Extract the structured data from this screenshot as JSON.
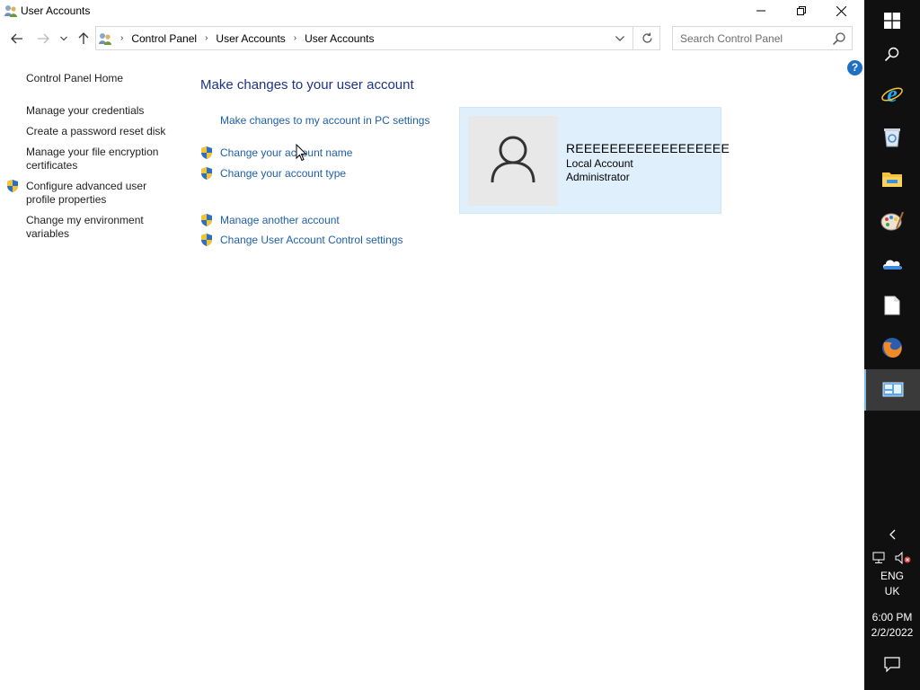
{
  "window": {
    "title": "User Accounts",
    "controls": {
      "minimize": "minimize",
      "maximize": "restore",
      "close": "close"
    }
  },
  "nav": {
    "breadcrumbs": [
      "Control Panel",
      "User Accounts",
      "User Accounts"
    ]
  },
  "search": {
    "placeholder": "Search Control Panel",
    "value": ""
  },
  "help": {
    "label": "?"
  },
  "left_pane": {
    "home": "Control Panel Home",
    "links": [
      "Manage your credentials",
      "Create a password reset disk",
      "Manage your file encryption certificates",
      "Configure advanced user profile properties",
      "Change my environment variables"
    ]
  },
  "main": {
    "title": "Make changes to your user account",
    "tasks": [
      "Make changes to my account in PC settings",
      "Change your account name",
      "Change your account type",
      "Manage another account",
      "Change User Account Control settings"
    ]
  },
  "account": {
    "name": "REEEEEEEEEEEEEEEEEE",
    "type": "Local Account",
    "role": "Administrator"
  },
  "taskbar": {
    "language": "ENG",
    "region": "UK",
    "time": "6:00 PM",
    "date": "2/2/2022"
  },
  "colors": {
    "link": "#1e5fa8",
    "title": "#1e3287",
    "tile": "#dff0fc",
    "taskbar": "#101010"
  }
}
